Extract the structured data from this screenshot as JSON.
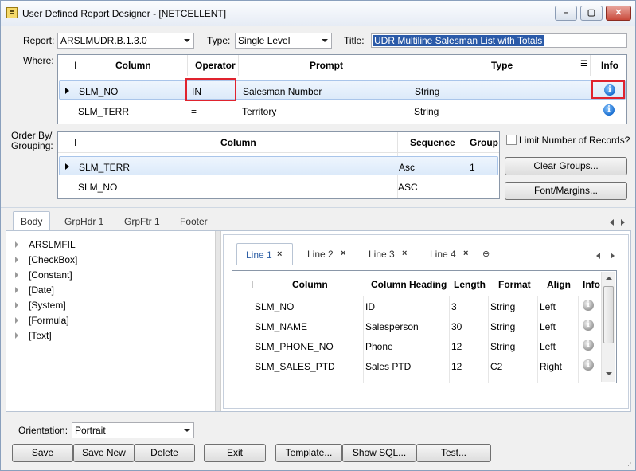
{
  "window": {
    "title": "User Defined Report Designer - [NETCELLENT]",
    "minimize_label": "–",
    "maximize_label": "▢",
    "close_label": "✕"
  },
  "header": {
    "report_label": "Report:",
    "report_value": "ARSLMUDR.B.1.3.0",
    "type_label": "Type:",
    "type_value": "Single Level",
    "title_label": "Title:",
    "title_value": "UDR Multiline Salesman List with Totals"
  },
  "where": {
    "label": "Where:",
    "columns": [
      "I",
      "Column",
      "Operator",
      "Prompt",
      "Type",
      "Info"
    ],
    "rows": [
      {
        "column": "SLM_NO",
        "operator": "IN",
        "prompt": "Salesman Number",
        "type": "String"
      },
      {
        "column": "SLM_TERR",
        "operator": "=",
        "prompt": "Territory",
        "type": "String"
      }
    ]
  },
  "order_by": {
    "label_line1": "Order By/",
    "label_line2": "Grouping:",
    "columns": [
      "I",
      "Column",
      "Sequence",
      "Group"
    ],
    "rows": [
      {
        "column": "SLM_TERR",
        "sequence": "Asc",
        "group": "1"
      },
      {
        "column": "SLM_NO",
        "sequence": "ASC",
        "group": ""
      }
    ]
  },
  "side_controls": {
    "limit_records_label": "Limit Number of Records?",
    "clear_groups": "Clear Groups...",
    "font_margins": "Font/Margins..."
  },
  "section_tabs": [
    "Body",
    "GrpHdr 1",
    "GrpFtr 1",
    "Footer"
  ],
  "tree": [
    "ARSLMFIL",
    "[CheckBox]",
    "[Constant]",
    "[Date]",
    "[System]",
    "[Formula]",
    "[Text]"
  ],
  "line_tabs": [
    "Line 1",
    "Line 2",
    "Line 3",
    "Line 4"
  ],
  "line_tab_close": "×",
  "line_tab_add": "⊕",
  "line_grid": {
    "columns": [
      "I",
      "Column",
      "Column Heading",
      "Length",
      "Format",
      "Align",
      "Info"
    ],
    "rows": [
      {
        "column": "SLM_NO",
        "heading": "ID",
        "length": "3",
        "format": "String",
        "align": "Left"
      },
      {
        "column": "SLM_NAME",
        "heading": "Salesperson",
        "length": "30",
        "format": "String",
        "align": "Left"
      },
      {
        "column": "SLM_PHONE_NO",
        "heading": "Phone",
        "length": "12",
        "format": "String",
        "align": "Left"
      },
      {
        "column": "SLM_SALES_PTD",
        "heading": "Sales PTD",
        "length": "12",
        "format": "C2",
        "align": "Right"
      }
    ]
  },
  "footer": {
    "orientation_label": "Orientation:",
    "orientation_value": "Portrait",
    "buttons": [
      "Save",
      "Save New",
      "Delete",
      "Exit",
      "Template...",
      "Show SQL...",
      "Test..."
    ]
  },
  "colors": {
    "highlight_red": "#e0232e",
    "info_blue": "#1a6fd1",
    "selection_blue": "#dceafa"
  }
}
